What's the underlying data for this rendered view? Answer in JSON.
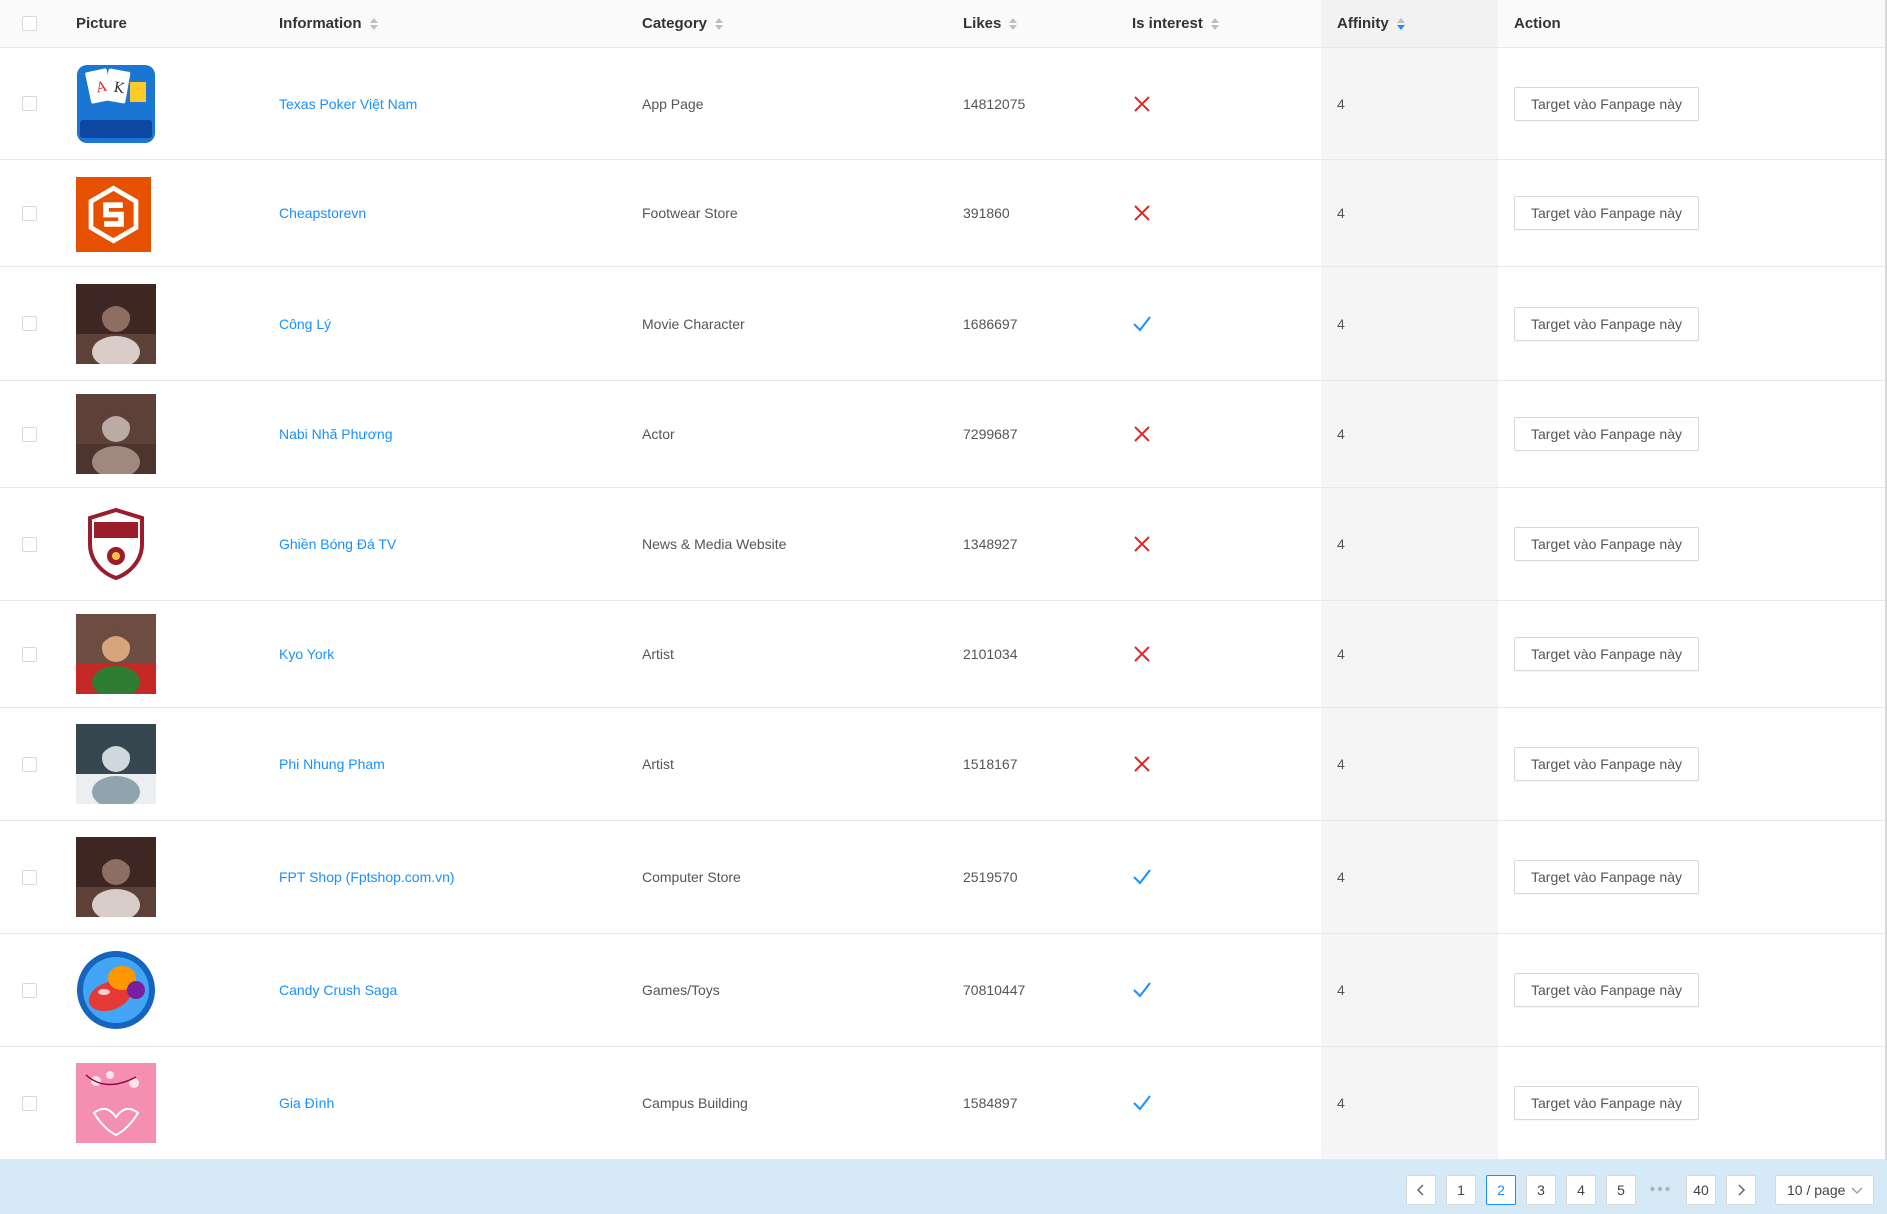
{
  "table": {
    "columns": {
      "picture": "Picture",
      "information": "Information",
      "category": "Category",
      "likes": "Likes",
      "is_interest": "Is interest",
      "affinity": "Affinity",
      "action": "Action"
    },
    "sorted_column": "affinity",
    "sort_order": "descending",
    "action_label": "Target vào Fanpage này",
    "rows": [
      {
        "name": "Texas Poker Việt Nam",
        "category": "App Page",
        "likes": "14812075",
        "is_interest": false,
        "affinity": "4",
        "picture": "poker-app-logo"
      },
      {
        "name": "Cheapstorevn",
        "category": "Footwear Store",
        "likes": "391860",
        "is_interest": false,
        "affinity": "4",
        "picture": "orange-s-logo"
      },
      {
        "name": "Công Lý",
        "category": "Movie Character",
        "likes": "1686697",
        "is_interest": true,
        "affinity": "4",
        "picture": "person-photo"
      },
      {
        "name": "Nabi Nhã Phương",
        "category": "Actor",
        "likes": "7299687",
        "is_interest": false,
        "affinity": "4",
        "picture": "person-photo"
      },
      {
        "name": "Ghiền Bóng Đá TV",
        "category": "News & Media Website",
        "likes": "1348927",
        "is_interest": false,
        "affinity": "4",
        "picture": "shield-crest-logo"
      },
      {
        "name": "Kyo York",
        "category": "Artist",
        "likes": "2101034",
        "is_interest": false,
        "affinity": "4",
        "picture": "person-photo"
      },
      {
        "name": "Phi Nhung Pham",
        "category": "Artist",
        "likes": "1518167",
        "is_interest": false,
        "affinity": "4",
        "picture": "person-photo"
      },
      {
        "name": "FPT Shop (Fptshop.com.vn)",
        "category": "Computer Store",
        "likes": "2519570",
        "is_interest": true,
        "affinity": "4",
        "picture": "person-photo"
      },
      {
        "name": "Candy Crush Saga",
        "category": "Games/Toys",
        "likes": "70810447",
        "is_interest": true,
        "affinity": "4",
        "picture": "candy-crush-logo"
      },
      {
        "name": "Gia Đình",
        "category": "Campus Building",
        "likes": "1584897",
        "is_interest": true,
        "affinity": "4",
        "picture": "pink-flower-logo"
      }
    ]
  },
  "pagination": {
    "pages": [
      "1",
      "2",
      "3",
      "4",
      "5"
    ],
    "current": "2",
    "last": "40",
    "ellipsis": "•••",
    "page_size": "10 / page"
  },
  "colors": {
    "link": "#1890ff",
    "cross": "#e02424",
    "check": "#1890ff",
    "footer_bg": "#d6e9f6"
  }
}
